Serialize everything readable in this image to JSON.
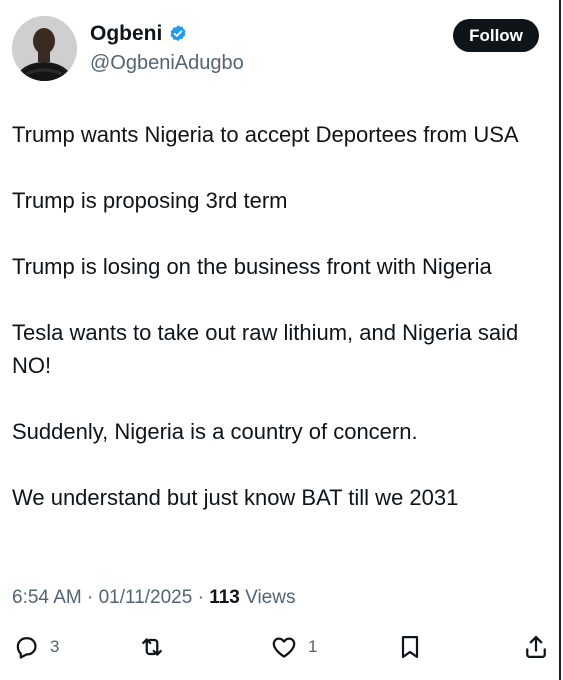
{
  "author": {
    "display_name": "Ogbeni",
    "handle": "@OgbeniAdugbo",
    "verified_icon": "verified-badge-icon",
    "avatar_icon": "profile-avatar"
  },
  "follow_label": "Follow",
  "tweet": {
    "paragraphs": [
      "Trump wants Nigeria to accept Deportees from USA",
      "Trump is proposing 3rd term",
      "Trump is losing on the business front with Nigeria",
      "Tesla wants to take out raw lithium, and Nigeria said NO!",
      "Suddenly, Nigeria is a country of concern.",
      "We understand but just know BAT till we 2031"
    ]
  },
  "meta": {
    "time": "6:54 AM",
    "separator": " · ",
    "date": "01/11/2025",
    "views_count": "113",
    "views_label": " Views"
  },
  "actions": {
    "reply_count": "3",
    "repost_count": "",
    "like_count": "1"
  },
  "colors": {
    "text_primary": "#0f1419",
    "text_secondary": "#536471",
    "verified_blue": "#1d9bf0",
    "button_bg": "#0f1419"
  }
}
